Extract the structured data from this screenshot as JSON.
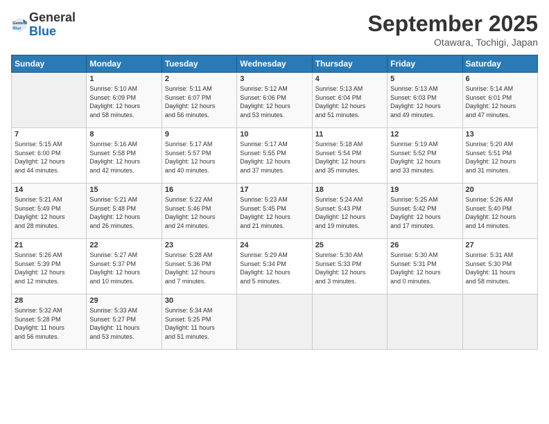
{
  "logo": {
    "line1": "General",
    "line2": "Blue"
  },
  "title": "September 2025",
  "subtitle": "Otawara, Tochigi, Japan",
  "weekdays": [
    "Sunday",
    "Monday",
    "Tuesday",
    "Wednesday",
    "Thursday",
    "Friday",
    "Saturday"
  ],
  "weeks": [
    [
      {
        "day": "",
        "info": ""
      },
      {
        "day": "1",
        "info": "Sunrise: 5:10 AM\nSunset: 6:09 PM\nDaylight: 12 hours\nand 58 minutes."
      },
      {
        "day": "2",
        "info": "Sunrise: 5:11 AM\nSunset: 6:07 PM\nDaylight: 12 hours\nand 56 minutes."
      },
      {
        "day": "3",
        "info": "Sunrise: 5:12 AM\nSunset: 6:06 PM\nDaylight: 12 hours\nand 53 minutes."
      },
      {
        "day": "4",
        "info": "Sunrise: 5:13 AM\nSunset: 6:04 PM\nDaylight: 12 hours\nand 51 minutes."
      },
      {
        "day": "5",
        "info": "Sunrise: 5:13 AM\nSunset: 6:03 PM\nDaylight: 12 hours\nand 49 minutes."
      },
      {
        "day": "6",
        "info": "Sunrise: 5:14 AM\nSunset: 6:01 PM\nDaylight: 12 hours\nand 47 minutes."
      }
    ],
    [
      {
        "day": "7",
        "info": "Sunrise: 5:15 AM\nSunset: 6:00 PM\nDaylight: 12 hours\nand 44 minutes."
      },
      {
        "day": "8",
        "info": "Sunrise: 5:16 AM\nSunset: 5:58 PM\nDaylight: 12 hours\nand 42 minutes."
      },
      {
        "day": "9",
        "info": "Sunrise: 5:17 AM\nSunset: 5:57 PM\nDaylight: 12 hours\nand 40 minutes."
      },
      {
        "day": "10",
        "info": "Sunrise: 5:17 AM\nSunset: 5:55 PM\nDaylight: 12 hours\nand 37 minutes."
      },
      {
        "day": "11",
        "info": "Sunrise: 5:18 AM\nSunset: 5:54 PM\nDaylight: 12 hours\nand 35 minutes."
      },
      {
        "day": "12",
        "info": "Sunrise: 5:19 AM\nSunset: 5:52 PM\nDaylight: 12 hours\nand 33 minutes."
      },
      {
        "day": "13",
        "info": "Sunrise: 5:20 AM\nSunset: 5:51 PM\nDaylight: 12 hours\nand 31 minutes."
      }
    ],
    [
      {
        "day": "14",
        "info": "Sunrise: 5:21 AM\nSunset: 5:49 PM\nDaylight: 12 hours\nand 28 minutes."
      },
      {
        "day": "15",
        "info": "Sunrise: 5:21 AM\nSunset: 5:48 PM\nDaylight: 12 hours\nand 26 minutes."
      },
      {
        "day": "16",
        "info": "Sunrise: 5:22 AM\nSunset: 5:46 PM\nDaylight: 12 hours\nand 24 minutes."
      },
      {
        "day": "17",
        "info": "Sunrise: 5:23 AM\nSunset: 5:45 PM\nDaylight: 12 hours\nand 21 minutes."
      },
      {
        "day": "18",
        "info": "Sunrise: 5:24 AM\nSunset: 5:43 PM\nDaylight: 12 hours\nand 19 minutes."
      },
      {
        "day": "19",
        "info": "Sunrise: 5:25 AM\nSunset: 5:42 PM\nDaylight: 12 hours\nand 17 minutes."
      },
      {
        "day": "20",
        "info": "Sunrise: 5:26 AM\nSunset: 5:40 PM\nDaylight: 12 hours\nand 14 minutes."
      }
    ],
    [
      {
        "day": "21",
        "info": "Sunrise: 5:26 AM\nSunset: 5:39 PM\nDaylight: 12 hours\nand 12 minutes."
      },
      {
        "day": "22",
        "info": "Sunrise: 5:27 AM\nSunset: 5:37 PM\nDaylight: 12 hours\nand 10 minutes."
      },
      {
        "day": "23",
        "info": "Sunrise: 5:28 AM\nSunset: 5:36 PM\nDaylight: 12 hours\nand 7 minutes."
      },
      {
        "day": "24",
        "info": "Sunrise: 5:29 AM\nSunset: 5:34 PM\nDaylight: 12 hours\nand 5 minutes."
      },
      {
        "day": "25",
        "info": "Sunrise: 5:30 AM\nSunset: 5:33 PM\nDaylight: 12 hours\nand 3 minutes."
      },
      {
        "day": "26",
        "info": "Sunrise: 5:30 AM\nSunset: 5:31 PM\nDaylight: 12 hours\nand 0 minutes."
      },
      {
        "day": "27",
        "info": "Sunrise: 5:31 AM\nSunset: 5:30 PM\nDaylight: 11 hours\nand 58 minutes."
      }
    ],
    [
      {
        "day": "28",
        "info": "Sunrise: 5:32 AM\nSunset: 5:28 PM\nDaylight: 11 hours\nand 56 minutes."
      },
      {
        "day": "29",
        "info": "Sunrise: 5:33 AM\nSunset: 5:27 PM\nDaylight: 11 hours\nand 53 minutes."
      },
      {
        "day": "30",
        "info": "Sunrise: 5:34 AM\nSunset: 5:25 PM\nDaylight: 11 hours\nand 51 minutes."
      },
      {
        "day": "",
        "info": ""
      },
      {
        "day": "",
        "info": ""
      },
      {
        "day": "",
        "info": ""
      },
      {
        "day": "",
        "info": ""
      }
    ]
  ]
}
